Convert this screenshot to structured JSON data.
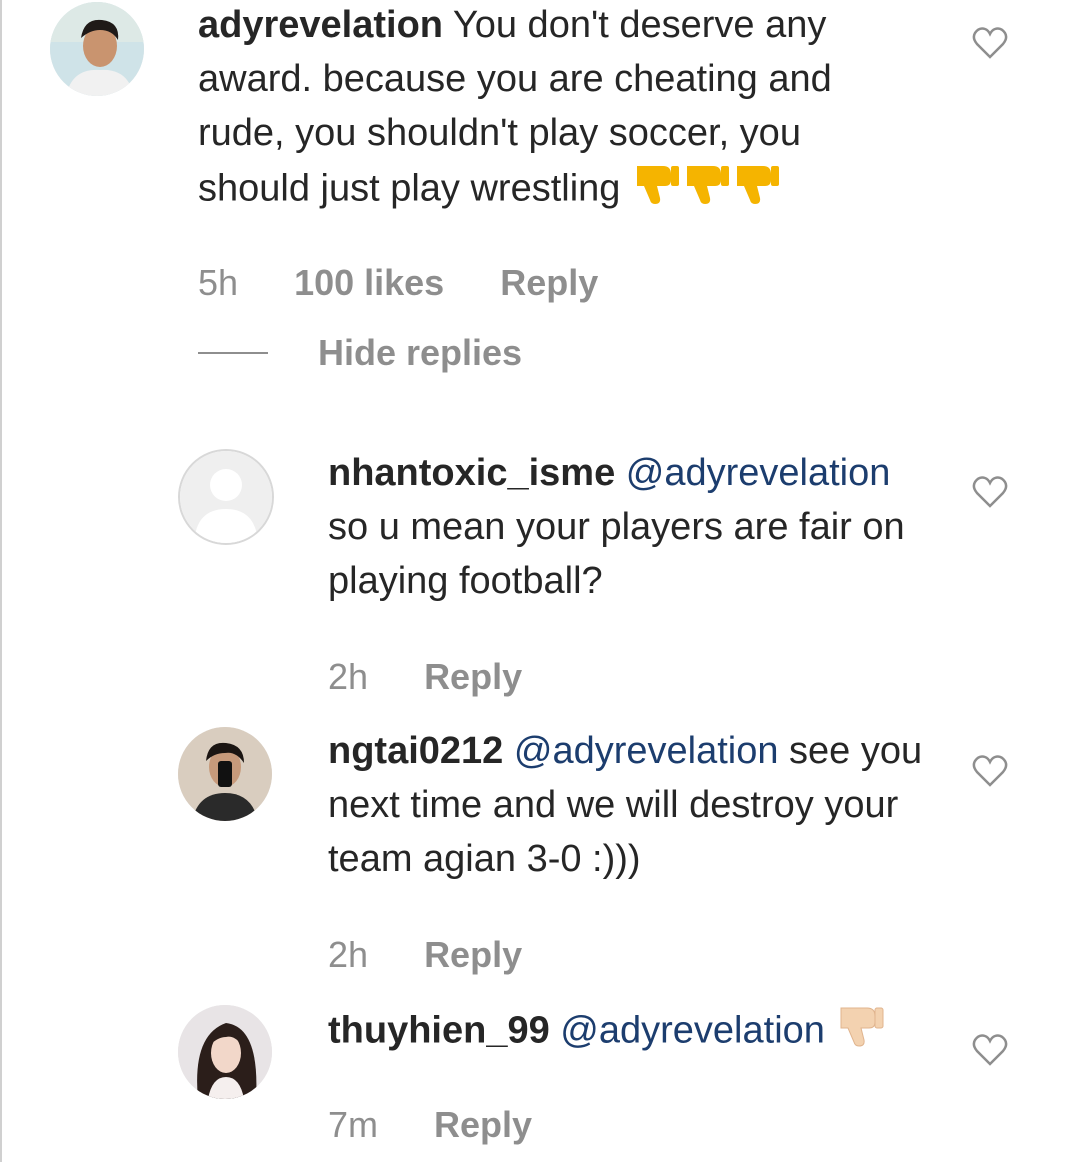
{
  "comments": [
    {
      "username": "adyrevelation",
      "text": "You don't deserve any award. because you are cheating and rude, you shouldn't play soccer, you should just play wrestling",
      "emoji": "👎👎👎",
      "time": "5h",
      "likes": "100 likes",
      "reply": "Reply"
    },
    {
      "username": "nhantoxic_isme",
      "mention": "@adyrevelation",
      "text": "so u mean your players are fair on playing football?",
      "time": "2h",
      "reply": "Reply"
    },
    {
      "username": "ngtai0212",
      "mention": "@adyrevelation",
      "text_inline": "see",
      "text": "you next time and we will destroy your team agian 3-0 :)))",
      "time": "2h",
      "reply": "Reply"
    },
    {
      "username": "thuyhien_99",
      "mention": "@adyrevelation",
      "emoji": "👎",
      "time": "7m",
      "reply": "Reply"
    }
  ],
  "hide_replies": "Hide replies",
  "icons": {
    "like": "heart-outline-icon",
    "thumb_color_main": "#f5b400",
    "thumb_color_light": "#f3d2b0"
  }
}
